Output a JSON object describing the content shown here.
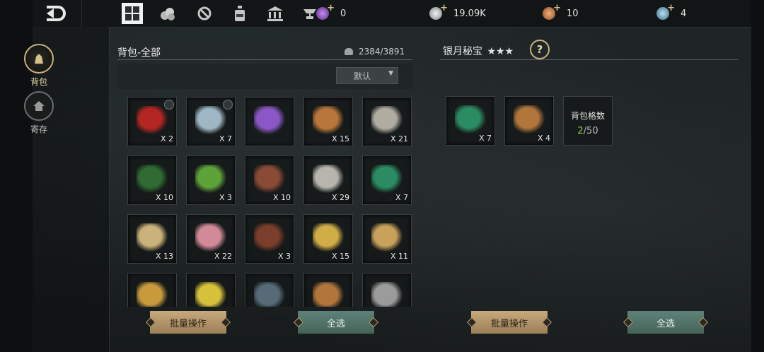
{
  "currencies": [
    {
      "icon": "purple-gem-icon",
      "value": "0"
    },
    {
      "icon": "silver-coin-icon",
      "value": "19.09K"
    },
    {
      "icon": "bronze-coin-icon",
      "value": "10"
    },
    {
      "icon": "blue-crystal-icon",
      "value": "4"
    }
  ],
  "sidebar": {
    "items": [
      {
        "label": "背包",
        "icon": "bag-icon"
      },
      {
        "label": "寄存",
        "icon": "storage-house-icon"
      }
    ]
  },
  "backpack": {
    "title": "背包-全部",
    "capacity": "2384/3891",
    "sort": "默认",
    "tabs": [
      "grid-all-icon",
      "materials-icon",
      "disabled-icon",
      "potion-bottle-icon",
      "bank-building-icon",
      "anvil-icon"
    ]
  },
  "items": [
    {
      "name": "red-meat",
      "qty": "X 2",
      "lock": true,
      "color": "#b32622"
    },
    {
      "name": "syringe",
      "qty": "X 7",
      "lock": true,
      "color": "#9fb7c4"
    },
    {
      "name": "lavender",
      "qty": "",
      "lock": false,
      "color": "#8b57c7"
    },
    {
      "name": "bread",
      "qty": "X 15",
      "lock": false,
      "color": "#b8763a"
    },
    {
      "name": "chain",
      "qty": "X 21",
      "lock": false,
      "color": "#b0aca2"
    },
    {
      "name": "green-book",
      "qty": "X 10",
      "lock": false,
      "color": "#2f6b33"
    },
    {
      "name": "herb-leaves",
      "qty": "X 3",
      "lock": false,
      "color": "#5ea33a"
    },
    {
      "name": "steak",
      "qty": "X 10",
      "lock": false,
      "color": "#8a4a35"
    },
    {
      "name": "metal-sheet",
      "qty": "X 29",
      "lock": false,
      "color": "#b7b5ad"
    },
    {
      "name": "green-potion",
      "qty": "X 7",
      "lock": false,
      "color": "#2b8b63"
    },
    {
      "name": "cloth",
      "qty": "X 13",
      "lock": false,
      "color": "#cbb27a"
    },
    {
      "name": "pink-yarn",
      "qty": "X 22",
      "lock": false,
      "color": "#d28a98"
    },
    {
      "name": "grilled-meat",
      "qty": "X 3",
      "lock": false,
      "color": "#7a3e2b"
    },
    {
      "name": "gold-mesh",
      "qty": "X 15",
      "lock": false,
      "color": "#d1ad47"
    },
    {
      "name": "parchment-roll",
      "qty": "X 11",
      "lock": false,
      "color": "#c9a15a"
    },
    {
      "name": "gold-bar",
      "qty": "",
      "lock": false,
      "color": "#c99a3c"
    },
    {
      "name": "yellow-powder",
      "qty": "",
      "lock": false,
      "color": "#d6c23a"
    },
    {
      "name": "ore-on-leaf",
      "qty": "",
      "lock": false,
      "color": "#566a78"
    },
    {
      "name": "seed-pouch",
      "qty": "",
      "lock": false,
      "color": "#b2763d"
    },
    {
      "name": "spear-head",
      "qty": "",
      "lock": false,
      "color": "#9b9b9b"
    }
  ],
  "treasure": {
    "title": "银月秘宝",
    "stars": "★★★",
    "help": "?",
    "items": [
      {
        "name": "green-potion",
        "qty": "X 7",
        "color": "#2b8b63"
      },
      {
        "name": "seed-pouch",
        "qty": "X 4",
        "color": "#b2763d"
      }
    ],
    "capacity_label": "背包格数",
    "capacity_used": "2",
    "capacity_total": "/50"
  },
  "buttons": {
    "batch": "批量操作",
    "select_all": "全选"
  }
}
